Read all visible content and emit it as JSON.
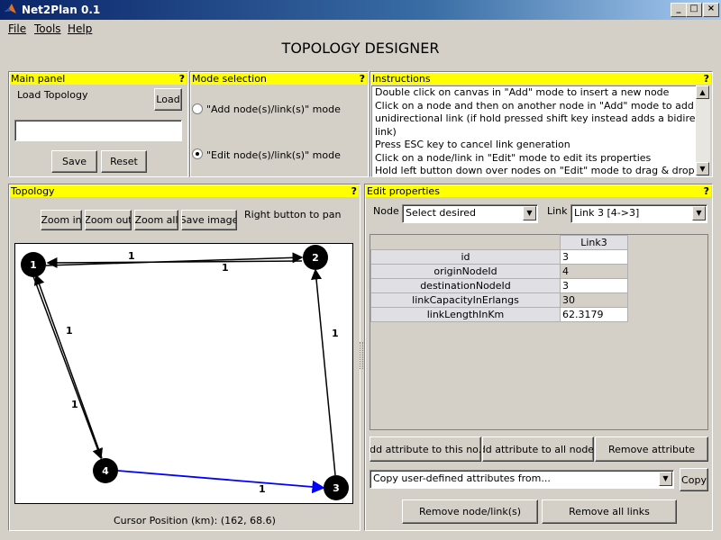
{
  "window": {
    "title": "Net2Plan 0.1"
  },
  "menu": [
    {
      "label": "File"
    },
    {
      "label": "Tools"
    },
    {
      "label": "Help"
    }
  ],
  "page_title": "TOPOLOGY DESIGNER",
  "main_panel": {
    "header": "Main panel",
    "help": "?",
    "load_label": "Load Topology",
    "load_button": "Load",
    "file_value": "",
    "save_button": "Save",
    "reset_button": "Reset"
  },
  "mode_panel": {
    "header": "Mode selection",
    "help": "?",
    "add_mode": "\"Add node(s)/link(s)\" mode",
    "edit_mode": "\"Edit node(s)/link(s)\" mode",
    "selected": "edit"
  },
  "instructions": {
    "header": "Instructions",
    "help": "?",
    "lines": [
      "Double click on canvas in \"Add\" mode to insert a new node",
      "Click on a node and then on another node in \"Add\" mode to add an",
      "unidirectional link (if hold pressed shift key instead adds a bidirectional",
      "link)",
      "Press ESC key to cancel link generation",
      "Click on a node/link in \"Edit\" mode to edit its properties",
      "Hold left button down over nodes on \"Edit\" mode to drag & drop it"
    ]
  },
  "topology": {
    "header": "Topology",
    "help": "?",
    "zoom_in": "Zoom in",
    "zoom_out": "Zoom out",
    "zoom_all": "Zoom all",
    "save_image": "Save image",
    "pan_hint": "Right button to pan",
    "cursor_position": "Cursor Position (km): (162, 68.6)",
    "nodes": [
      {
        "label": "1"
      },
      {
        "label": "2"
      },
      {
        "label": "3"
      },
      {
        "label": "4"
      }
    ],
    "link_labels": [
      "1",
      "1",
      "1",
      "1",
      "1",
      "1"
    ],
    "selected_link_color": "#0000ff"
  },
  "edit_properties": {
    "header": "Edit properties",
    "help": "?",
    "node_label": "Node",
    "node_select": "Select desired",
    "link_label": "Link",
    "link_select": "Link 3 [4->3]",
    "column_header": "Link3",
    "rows": [
      {
        "name": "id",
        "value": "3"
      },
      {
        "name": "originNodeId",
        "value": "4"
      },
      {
        "name": "destinationNodeId",
        "value": "3"
      },
      {
        "name": "linkCapacityInErlangs",
        "value": "30"
      },
      {
        "name": "linkLengthInKm",
        "value": "62.3179"
      }
    ],
    "add_attr_this": "Add attribute to this no...",
    "add_attr_all": "Add attribute to all node...",
    "remove_attr": "Remove attribute",
    "copy_select": "Copy user-defined attributes from...",
    "copy_button": "Copy",
    "remove_node_link": "Remove node/link(s)",
    "remove_all_links": "Remove all links"
  },
  "colors": {
    "header_yellow": "#ffff00",
    "title_blue": "#0a246a",
    "face": "#d4d0c8"
  }
}
